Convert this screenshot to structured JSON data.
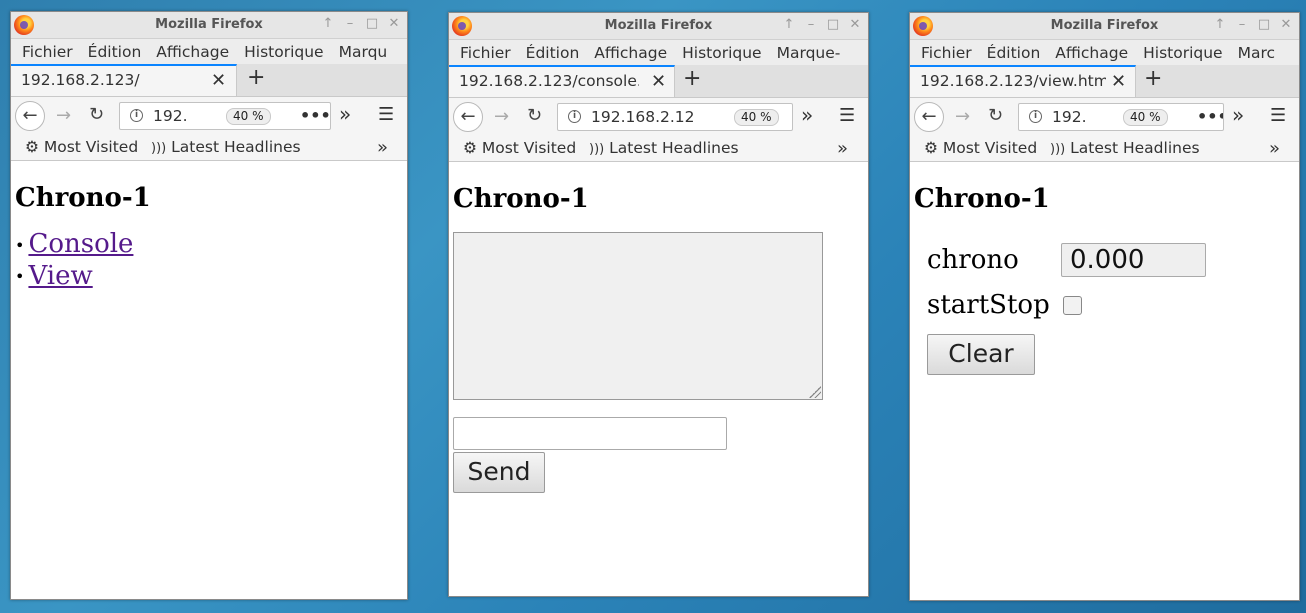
{
  "windows": [
    {
      "title": "Mozilla Firefox",
      "menu": [
        "Fichier",
        "Édition",
        "Affichage",
        "Historique",
        "Marqu"
      ],
      "tab_label": "192.168.2.123/",
      "url": "192.",
      "zoom": "40 %",
      "bookmarks": [
        "Most Visited",
        "Latest Headlines"
      ],
      "page_title": "Chrono-1",
      "links": [
        "Console",
        "View"
      ]
    },
    {
      "title": "Mozilla Firefox",
      "menu": [
        "Fichier",
        "Édition",
        "Affichage",
        "Historique",
        "Marque-"
      ],
      "tab_label": "192.168.2.123/console.",
      "url": "192.168.2.12",
      "zoom": "40 %",
      "bookmarks": [
        "Most Visited",
        "Latest Headlines"
      ],
      "page_title": "Chrono-1",
      "send_label": "Send",
      "send_input_value": ""
    },
    {
      "title": "Mozilla Firefox",
      "menu": [
        "Fichier",
        "Édition",
        "Affichage",
        "Historique",
        "Marc"
      ],
      "tab_label": "192.168.2.123/view.htm",
      "url": "192.",
      "zoom": "40 %",
      "bookmarks": [
        "Most Visited",
        "Latest Headlines"
      ],
      "page_title": "Chrono-1",
      "chrono_label": "chrono",
      "chrono_value": "0.000",
      "startstop_label": "startStop",
      "startstop_checked": false,
      "clear_label": "Clear"
    }
  ],
  "window_controls": [
    "↑",
    "–",
    "□",
    "✕"
  ]
}
